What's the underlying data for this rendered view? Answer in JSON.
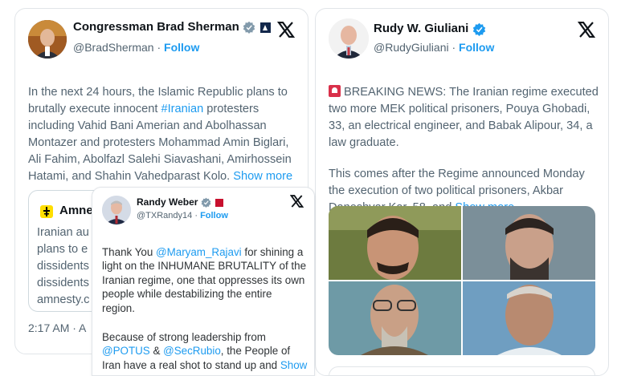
{
  "sherman": {
    "name": "Congressman Brad Sherman",
    "handle": "@BradSherman",
    "separator": "·",
    "follow": "Follow",
    "text_1": "In the next 24 hours, the Islamic Republic plans to brutally execute innocent ",
    "hashtag": "#Iranian",
    "text_2": " protesters including Vahid Bani Amerian and Abolhassan Montazer and protesters Mohammad Amin Biglari, Ali Fahim, Abolfazl Salehi Siavashani, Amirhossein Hatami, and Shahin Vahedparast Kolo. ",
    "show_more": "Show more",
    "time": "2:17 AM · A"
  },
  "quoted": {
    "name_partial": "Amne",
    "lines": [
      "Iranian au",
      "plans to e",
      "dissidents",
      "dissidents",
      "amnesty.c"
    ]
  },
  "weber": {
    "name": "Randy Weber",
    "handle": "@TXRandy14",
    "separator": "·",
    "follow": "Follow",
    "p1_1": "Thank You ",
    "mention_1": "@Maryam_Rajavi",
    "p1_2": " for shining a light on the INHUMANE BRUTALITY of the Iranian regime, one that oppresses its own people while destabilizing the entire region.",
    "p2_1": "Because of strong leadership from ",
    "mention_2": "@POTUS",
    "p2_2": " & ",
    "mention_3": "@SecRubio",
    "p2_3": ", the People of Iran have a real shot to stand up and ",
    "show_more": "Show more"
  },
  "giuliani": {
    "name": "Rudy W. Giuliani",
    "handle": "@RudyGiuliani",
    "separator": "·",
    "follow": "Follow",
    "p1": "BREAKING NEWS: The Iranian regime executed two more MEK political prisoners, Pouya Ghobadi, 33, an electrical engineer, and Babak Alipour, 34, a law graduate.",
    "p2_1": "This comes after the Regime announced Monday the execution of two political prisoners, Akbar Daneshvar Kar, 58, and ",
    "show_more": "Show more"
  },
  "icons": {
    "x_logo": "x-logo-icon",
    "verified": "verified-badge-icon",
    "siren": "siren-icon"
  },
  "colors": {
    "link": "#1d9bf0",
    "verified_grey": "#829aab",
    "verified_blue": "#1d9bf0",
    "siren_red": "#d9304a"
  }
}
